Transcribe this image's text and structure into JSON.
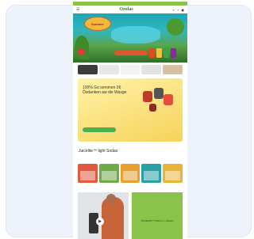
{
  "header": {
    "logo": "Ozolas",
    "icons": [
      "search-icon",
      "account-icon",
      "cart-icon"
    ],
    "menu_icon": "menu-icon"
  },
  "hero": {
    "badge": "Summer",
    "tagline": "",
    "cta": ""
  },
  "category_strip": {
    "items": [
      "",
      "",
      "",
      "",
      ""
    ]
  },
  "promo": {
    "title": "100% Go semmen 06 Ösdanken aw die Wasge",
    "subtitle": "",
    "button": ""
  },
  "products_section": {
    "title": "Juicelite™ light Sodas",
    "subtitle": "",
    "boxes": [
      "#e15a3e",
      "#6fa948",
      "#e6a032",
      "#2aa0a4",
      "#e8b43a"
    ]
  },
  "feature": {
    "play_icon": "play-icon",
    "text": "JUICEZIN™ SODA in 1 Minuts"
  },
  "colors": {
    "accent": "#8bc34a",
    "brand_dark": "#2e7d32",
    "promo": "#f6d35a"
  }
}
